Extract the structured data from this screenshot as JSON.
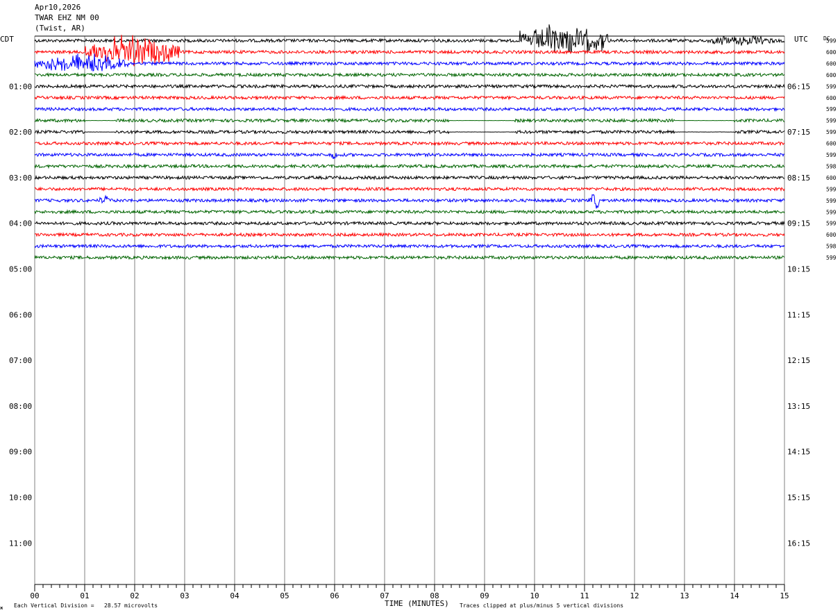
{
  "header": {
    "date": "Apr10,2026",
    "station": "TWAR EHZ NM 00",
    "location": "(Twist, AR)"
  },
  "footer": {
    "scale_note": "Each Vertical Division =   28.57 microvolts",
    "clip_note": "Traces clipped at plus/minus 5 vertical divisions",
    "corner_mark": "ж"
  },
  "colors": {
    "trace_cycle": [
      "#000000",
      "#ff0000",
      "#0000ff",
      "#006400"
    ],
    "grid": "#808080"
  },
  "chart_data": {
    "type": "line",
    "subtype": "helicorder",
    "xlabel": "TIME (MINUTES)",
    "xlim": [
      0,
      15
    ],
    "x_ticks": [
      "00",
      "01",
      "02",
      "03",
      "04",
      "05",
      "06",
      "07",
      "08",
      "09",
      "10",
      "11",
      "12",
      "13",
      "14",
      "15"
    ],
    "left_axis_label": "CDT",
    "right_axis_label": "UTC",
    "dc_label": "DC",
    "left_hour_labels": [
      "01:00",
      "02:00",
      "03:00",
      "04:00",
      "05:00",
      "06:00",
      "07:00",
      "08:00",
      "09:00",
      "10:00",
      "11:00"
    ],
    "right_hour_labels": [
      "06:15",
      "07:15",
      "08:15",
      "09:15",
      "10:15",
      "11:15",
      "12:15",
      "13:15",
      "14:15",
      "15:15",
      "16:15"
    ],
    "rows_total": 48,
    "rows_per_hour": 4,
    "dc_values": [
      599,
      600,
      600,
      600,
      599,
      600,
      599,
      599,
      599,
      600,
      599,
      598,
      600,
      599,
      599,
      599,
      599,
      600,
      598,
      599
    ],
    "events": [
      {
        "row": 0,
        "start_min": 9.7,
        "end_min": 11.5,
        "amplitude": "high"
      },
      {
        "row": 0,
        "start_min": 13.4,
        "end_min": 14.8,
        "amplitude": "low"
      },
      {
        "row": 1,
        "start_min": 1.0,
        "end_min": 2.9,
        "amplitude": "high"
      },
      {
        "row": 2,
        "start_min": 0.0,
        "end_min": 1.9,
        "amplitude": "medium"
      },
      {
        "row": 10,
        "start_min": 5.9,
        "end_min": 6.1,
        "amplitude": "low"
      },
      {
        "row": 14,
        "start_min": 1.3,
        "end_min": 1.5,
        "amplitude": "low"
      },
      {
        "row": 14,
        "start_min": 11.1,
        "end_min": 11.3,
        "amplitude": "medium"
      }
    ],
    "dropout_rows": [
      7,
      8
    ],
    "grid": true
  }
}
